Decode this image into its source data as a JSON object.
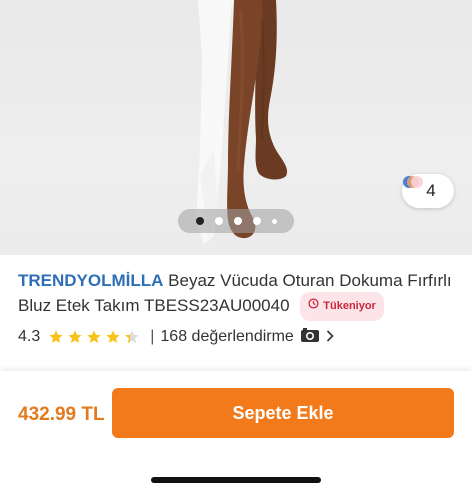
{
  "gallery": {
    "variant_count": "4",
    "slides": [
      {
        "state": "active"
      },
      {
        "state": "inactive"
      },
      {
        "state": "inactive"
      },
      {
        "state": "inactive"
      },
      {
        "state": "inactive"
      }
    ]
  },
  "product": {
    "brand": "TRENDYOLMİLLA",
    "name": "Beyaz Vücuda Oturan Dokuma Fırfırlı Bluz Etek Takım TBESS23AU00040",
    "badge_label": "Tükeniyor"
  },
  "rating": {
    "score": "4.3",
    "stars_value": 4.3,
    "separator": "|",
    "review_count_text": "168 değerlendirme"
  },
  "footer": {
    "price": "432.99 TL",
    "add_to_cart_label": "Sepete Ekle"
  },
  "colors": {
    "brand_blue": "#2e6fb6",
    "accent_orange": "#f27a1a",
    "star_yellow": "#f7c31b",
    "badge_red": "#c7283f"
  },
  "icons": {
    "variant": "color-variant-icon",
    "badge": "clock-icon",
    "camera": "camera-icon",
    "chevron": "chevron-right-icon"
  }
}
